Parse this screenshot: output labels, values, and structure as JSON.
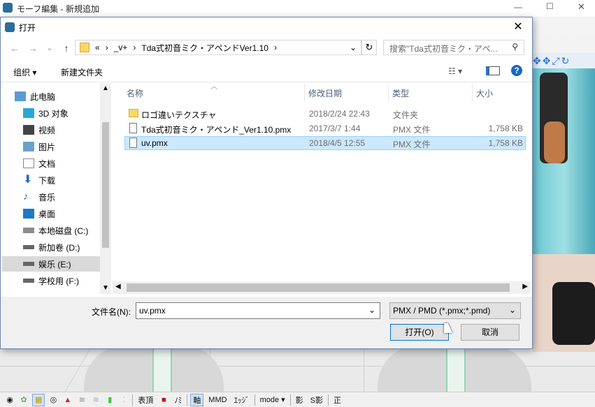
{
  "app": {
    "title": "モーフ編集 - 新規追加",
    "window_controls": [
      "—",
      "☐",
      "✕"
    ]
  },
  "dialog": {
    "title": "打开",
    "close": "✕",
    "nav": {
      "back": "←",
      "forward": "→",
      "down": "⌄",
      "up": "↑"
    },
    "address": {
      "prefix": "«",
      "crumbs": [
        "_v+",
        "Tda式初音ミク・アペンドVer1.10"
      ],
      "separator": "›"
    },
    "search_placeholder": "搜索\"Tda式初音ミク・アペ...",
    "toolbar": {
      "organize": "组织 ▾",
      "new_folder": "新建文件夹"
    },
    "nav_pane": [
      {
        "label": "此电脑",
        "icon": "computer-icon"
      },
      {
        "label": "3D 对象",
        "icon": "cube-icon"
      },
      {
        "label": "视频",
        "icon": "video-icon"
      },
      {
        "label": "图片",
        "icon": "pictures-icon"
      },
      {
        "label": "文档",
        "icon": "documents-icon"
      },
      {
        "label": "下载",
        "icon": "download-icon"
      },
      {
        "label": "音乐",
        "icon": "music-icon"
      },
      {
        "label": "桌面",
        "icon": "desktop-icon"
      },
      {
        "label": "本地磁盘 (C:)",
        "icon": "drive-icon"
      },
      {
        "label": "新加卷 (D:)",
        "icon": "drive-icon"
      },
      {
        "label": "娱乐 (E:)",
        "icon": "drive-icon",
        "selected": true
      },
      {
        "label": "学校用 (F:)",
        "icon": "drive-icon"
      }
    ],
    "columns": [
      "名称",
      "修改日期",
      "类型",
      "大小"
    ],
    "files": [
      {
        "name": "ロゴ違いテクスチャ",
        "date": "2018/2/24 22:43",
        "type": "文件夹",
        "size": "",
        "icon": "folder-icon"
      },
      {
        "name": "Tda式初音ミク・アペンド_Ver1.10.pmx",
        "date": "2017/3/7 1:44",
        "type": "PMX 文件",
        "size": "1,758 KB",
        "icon": "file-icon"
      },
      {
        "name": "uv.pmx",
        "date": "2018/4/5 12:55",
        "type": "PMX 文件",
        "size": "1,758 KB",
        "icon": "file-icon",
        "selected": true
      }
    ],
    "filename_label": "文件名(N):",
    "filename_value": "uv.pmx",
    "filter": "PMX / PMD (*.pmx;*.pmd)",
    "open_button": "打开(O)",
    "cancel_button": "取消"
  },
  "bottom_toolbar": [
    "表頂",
    "ﾉﾐ",
    "軸",
    "MMD",
    "ｴｯｼﾞ",
    "mode ▾",
    "影",
    "S影",
    "正"
  ]
}
